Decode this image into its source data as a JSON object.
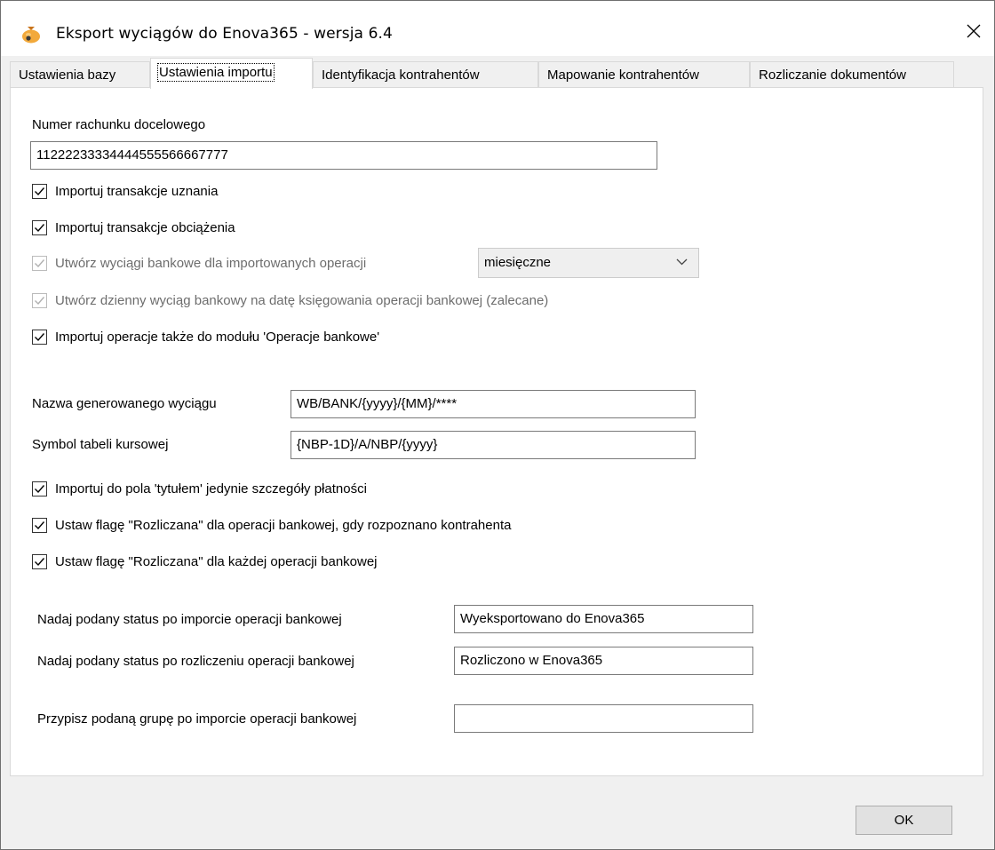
{
  "window": {
    "title": "Eksport wyciągów do Enova365 - wersja 6.4",
    "close_symbol": "✕"
  },
  "tabs": [
    {
      "label": "Ustawienia bazy",
      "active": false
    },
    {
      "label": "Ustawienia importu",
      "active": true
    },
    {
      "label": "Identyfikacja kontrahentów",
      "active": false
    },
    {
      "label": "Mapowanie kontrahentów",
      "active": false
    },
    {
      "label": "Rozliczanie dokumentów",
      "active": false
    }
  ],
  "account": {
    "label": "Numer rachunku docelowego",
    "value": "11222233334444555566667777"
  },
  "checks_top": [
    {
      "label": "Importuj transakcje uznania",
      "checked": true,
      "enabled": true
    },
    {
      "label": "Importuj transakcje obciążenia",
      "checked": true,
      "enabled": true
    },
    {
      "label": "Utwórz wyciągi bankowe dla importowanych operacji",
      "checked": true,
      "enabled": false
    },
    {
      "label": "Utwórz dzienny wyciąg bankowy na datę księgowania operacji bankowej (zalecane)",
      "checked": true,
      "enabled": false
    },
    {
      "label": "Importuj operacje także do modułu 'Operacje bankowe'",
      "checked": true,
      "enabled": true
    }
  ],
  "period_combo": {
    "value": "miesięczne"
  },
  "statement_name": {
    "label": "Nazwa generowanego wyciągu",
    "value": "WB/BANK/{yyyy}/{MM}/****"
  },
  "rate_table": {
    "label": "Symbol tabeli kursowej",
    "value": "{NBP-1D}/A/NBP/{yyyy}"
  },
  "checks_bottom": [
    {
      "label": "Importuj do pola 'tytułem' jedynie szczegóły płatności",
      "checked": true,
      "enabled": true
    },
    {
      "label": "Ustaw flagę \"Rozliczana\" dla operacji bankowej, gdy rozpoznano kontrahenta",
      "checked": true,
      "enabled": true
    },
    {
      "label": "Ustaw flagę \"Rozliczana\" dla każdej operacji bankowej",
      "checked": true,
      "enabled": true
    }
  ],
  "status_after_import": {
    "label": "Nadaj podany status po imporcie operacji bankowej",
    "value": "Wyeksportowano do Enova365"
  },
  "status_after_settle": {
    "label": "Nadaj podany status po rozliczeniu operacji bankowej",
    "value": "Rozliczono w Enova365"
  },
  "group_after_import": {
    "label": "Przypisz podaną grupę po imporcie operacji bankowej",
    "value": ""
  },
  "ok_button": {
    "label": "OK"
  },
  "colors": {
    "accent": "#f0a030",
    "window_bg": "#f0f0f0",
    "disabled_text": "#6d6d6d"
  }
}
